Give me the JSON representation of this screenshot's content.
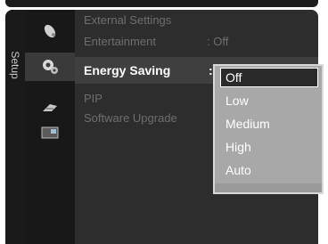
{
  "sidebar": {
    "label": "Setup"
  },
  "menu": {
    "items": [
      {
        "label": "External Settings",
        "value": ""
      },
      {
        "label": "Entertainment",
        "value": ": Off"
      },
      {
        "label": "Energy Saving",
        "value": ":"
      },
      {
        "label": "PIP",
        "value": ""
      },
      {
        "label": "Software Upgrade",
        "value": ""
      }
    ]
  },
  "dropdown": {
    "options": [
      "Off",
      "Low",
      "Medium",
      "High",
      "Auto"
    ],
    "selected": "Off"
  },
  "icons": [
    "antenna-icon",
    "gear-settings-icon",
    "satellite-icon",
    "pip-icon"
  ],
  "colors": {
    "panel": "#252525",
    "selected_row": "#3f3f3f",
    "dropdown_bg": "#a8a8a8"
  }
}
